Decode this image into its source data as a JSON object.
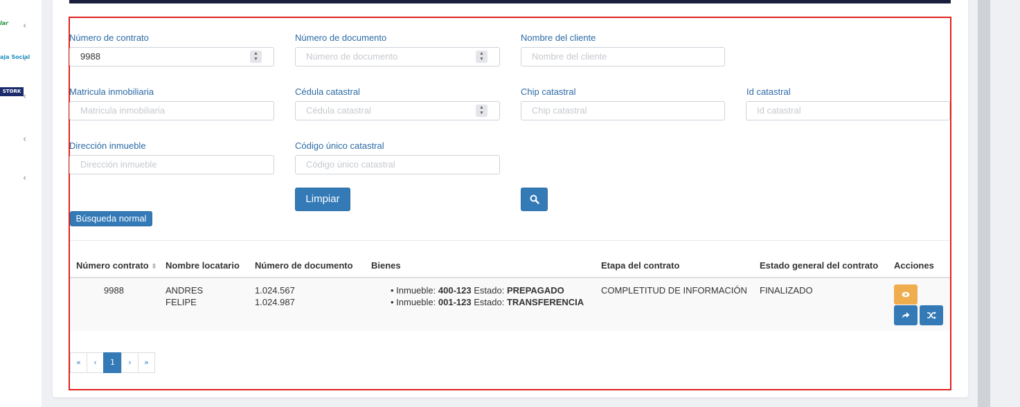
{
  "sidebar": {
    "logos": [
      "lar",
      "aja Social",
      "STORK"
    ]
  },
  "form": {
    "contract_number": {
      "label": "Número de contrato",
      "value": "9988"
    },
    "document_number": {
      "label": "Número de documento",
      "placeholder": "Número de documento"
    },
    "client_name": {
      "label": "Nombre del cliente",
      "placeholder": "Nombre del cliente"
    },
    "real_estate_registration": {
      "label": "Matricula inmobiliaria",
      "placeholder": "Matricula inmobiliaria"
    },
    "cadastral_id_card": {
      "label": "Cédula catastral",
      "placeholder": "Cédula catastral"
    },
    "cadastral_chip": {
      "label": "Chip catastral",
      "placeholder": "Chip catastral"
    },
    "cadastral_id": {
      "label": "Id catastral",
      "placeholder": "Id catastral"
    },
    "property_address": {
      "label": "Dirección inmueble",
      "placeholder": "Dirección inmueble"
    },
    "unique_cadastral_code": {
      "label": "Código único catastral",
      "placeholder": "Código único catastral"
    },
    "clear_label": "Limpiar",
    "normal_search_label": "Búsqueda normal"
  },
  "table": {
    "headers": [
      "Número contrato",
      "Nombre locatario",
      "Número de documento",
      "Bienes",
      "Etapa del contrato",
      "Estado general del contrato",
      "Acciones"
    ],
    "row": {
      "contract": "9988",
      "tenant_line1": "ANDRES",
      "tenant_line2": "FELIPE",
      "doc_line1": "1.024.567",
      "doc_line2": "1.024.987",
      "assets": [
        {
          "prefix": "Inmueble:",
          "code": "400-123",
          "state_label": "Estado:",
          "state": "PREPAGADO"
        },
        {
          "prefix": "Inmueble:",
          "code": "001-123",
          "state_label": "Estado:",
          "state": "TRANSFERENCIA"
        }
      ],
      "stage": "COMPLETITUD DE INFORMACIÓN",
      "general_state": "FINALIZADO"
    }
  },
  "pagination": {
    "first": "«",
    "prev": "‹",
    "current": "1",
    "next": "›",
    "last": "»"
  },
  "colors": {
    "primary": "#337ab7",
    "warning": "#f0ad4e",
    "label": "#2b6aa6",
    "frame": "#e0201c",
    "topbar": "#1a1f3d"
  },
  "icons": {
    "search": "search-icon",
    "view": "eye-icon",
    "forward": "share-icon",
    "shuffle": "shuffle-icon"
  }
}
